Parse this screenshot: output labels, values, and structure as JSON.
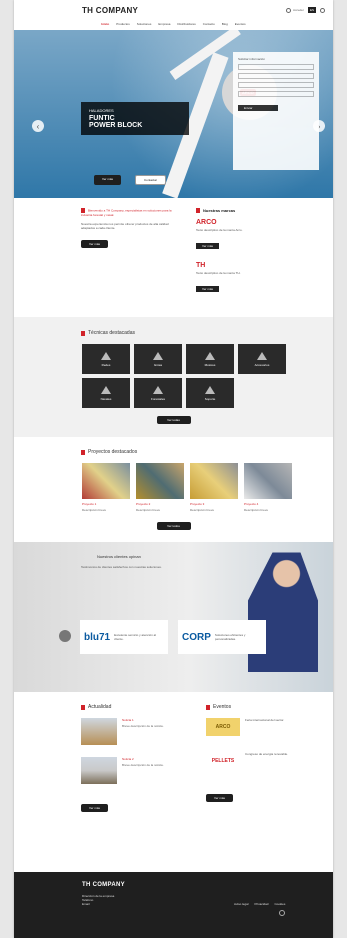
{
  "header": {
    "brand": "TH COMPANY",
    "top_links": [
      "Acceder",
      "ES"
    ],
    "language": "ES",
    "menu": [
      "Inicio",
      "Productos",
      "Soluciones",
      "Empresa",
      "Distribuidores",
      "Contacto",
      "Blog",
      "Eventos"
    ]
  },
  "hero": {
    "pre": "HALADORES",
    "title_lines": [
      "FUNTIC",
      "POWER BLOCK"
    ],
    "brand_badge": "ARCO",
    "btn_primary": "Ver más",
    "btn_secondary": "Contactar",
    "form": {
      "label": "Solicitar información",
      "fields": [
        "Nombre",
        "Email",
        "Teléfono",
        "Mensaje"
      ],
      "submit": "Enviar"
    }
  },
  "intro": {
    "lead": "Bienvenido a TH Company, especialistas en soluciones para la industria forestal y naval.",
    "body": "Nuestra experiencia nos permite ofrecer productos de alta calidad adaptados a cada cliente.",
    "button": "Ver más"
  },
  "brands": {
    "title": "Nuestras marcas",
    "items": [
      {
        "name": "ARCO",
        "text": "Texto descriptivo de la marca Arco.",
        "button": "Ver más"
      },
      {
        "name": "TH",
        "text": "Texto descriptivo de la marca TH.",
        "button": "Ver más"
      }
    ]
  },
  "tech": {
    "title": "Técnicas destacadas",
    "items": [
      "Redes",
      "Grúas",
      "Motores",
      "Accesorios",
      "Navales",
      "Forestales",
      "Soporte"
    ],
    "button": "Ver todas"
  },
  "projects": {
    "title": "Proyectos destacados",
    "cards": [
      {
        "title": "Proyecto 1",
        "desc": "Descripción breve"
      },
      {
        "title": "Proyecto 2",
        "desc": "Descripción breve"
      },
      {
        "title": "Proyecto 3",
        "desc": "Descripción breve"
      },
      {
        "title": "Proyecto 4",
        "desc": "Descripción breve"
      }
    ],
    "button": "Ver todos"
  },
  "clients": {
    "title": "Nuestros clientes opinan",
    "desc": "Testimonios de clientes satisfechos con nuestras soluciones.",
    "cards": [
      {
        "logo": "blu71",
        "text": "Excelente servicio y atención al cliente."
      },
      {
        "logo": "CORP",
        "text": "Soluciones eficientes y personalizadas."
      }
    ]
  },
  "news": {
    "title": "Actualidad",
    "items": [
      {
        "title": "Noticia 1",
        "text": "Breve descripción de la noticia."
      },
      {
        "title": "Noticia 2",
        "text": "Breve descripción de la noticia."
      }
    ],
    "button": "Ver más"
  },
  "events": {
    "title": "Eventos",
    "items": [
      {
        "logo": "ARCO",
        "text": "Feria internacional del sector."
      },
      {
        "logo": "PELLETS",
        "text": "Congreso de energía renovable."
      }
    ],
    "button": "Ver más"
  },
  "footer": {
    "brand": "TH COMPANY",
    "address": "Dirección de la empresa",
    "phone": "Teléfono",
    "email": "Email",
    "links": [
      "Aviso legal",
      "Privacidad",
      "Cookies"
    ]
  }
}
